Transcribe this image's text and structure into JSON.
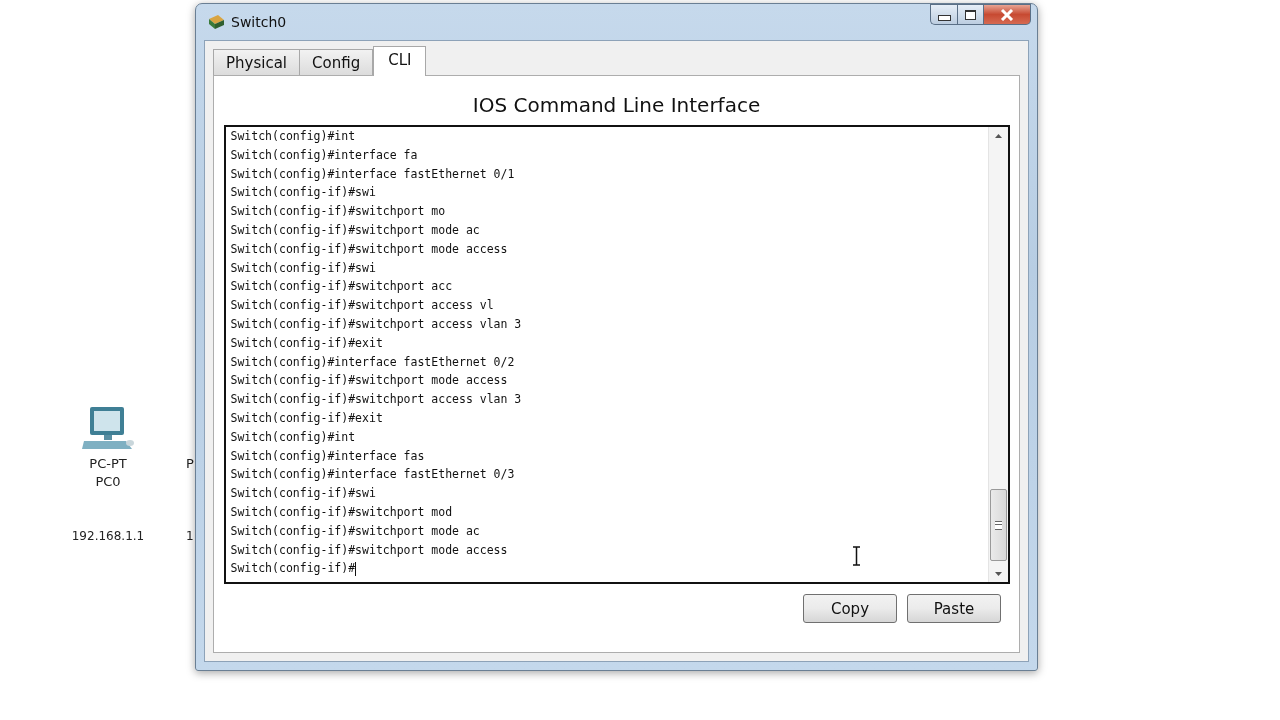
{
  "desktop": {
    "devices": [
      {
        "kind": "pc",
        "type": "PC-PT",
        "name": "PC0",
        "ip": "192.168.1.1"
      },
      {
        "kind": "partial",
        "type": "P",
        "ip": "1"
      }
    ]
  },
  "window": {
    "title": "Switch0",
    "tabs": [
      {
        "label": "Physical",
        "selected": false
      },
      {
        "label": "Config",
        "selected": false
      },
      {
        "label": "CLI",
        "selected": true
      }
    ],
    "heading": "IOS Command Line Interface",
    "terminal": {
      "lines": [
        "Switch(config)#int",
        "Switch(config)#interface fa",
        "Switch(config)#interface fastEthernet 0/1",
        "Switch(config-if)#swi",
        "Switch(config-if)#switchport mo",
        "Switch(config-if)#switchport mode ac",
        "Switch(config-if)#switchport mode access",
        "Switch(config-if)#swi",
        "Switch(config-if)#switchport acc",
        "Switch(config-if)#switchport access vl",
        "Switch(config-if)#switchport access vlan 3",
        "Switch(config-if)#exit",
        "Switch(config)#interface fastEthernet 0/2",
        "Switch(config-if)#switchport mode access",
        "Switch(config-if)#switchport access vlan 3",
        "Switch(config-if)#exit",
        "Switch(config)#int",
        "Switch(config)#interface fas",
        "Switch(config)#interface fastEthernet 0/3",
        "Switch(config-if)#swi",
        "Switch(config-if)#switchport mod",
        "Switch(config-if)#switchport mode ac",
        "Switch(config-if)#switchport mode access",
        "Switch(config-if)#"
      ],
      "cursor": true
    },
    "buttons": [
      "Copy",
      "Paste"
    ]
  }
}
